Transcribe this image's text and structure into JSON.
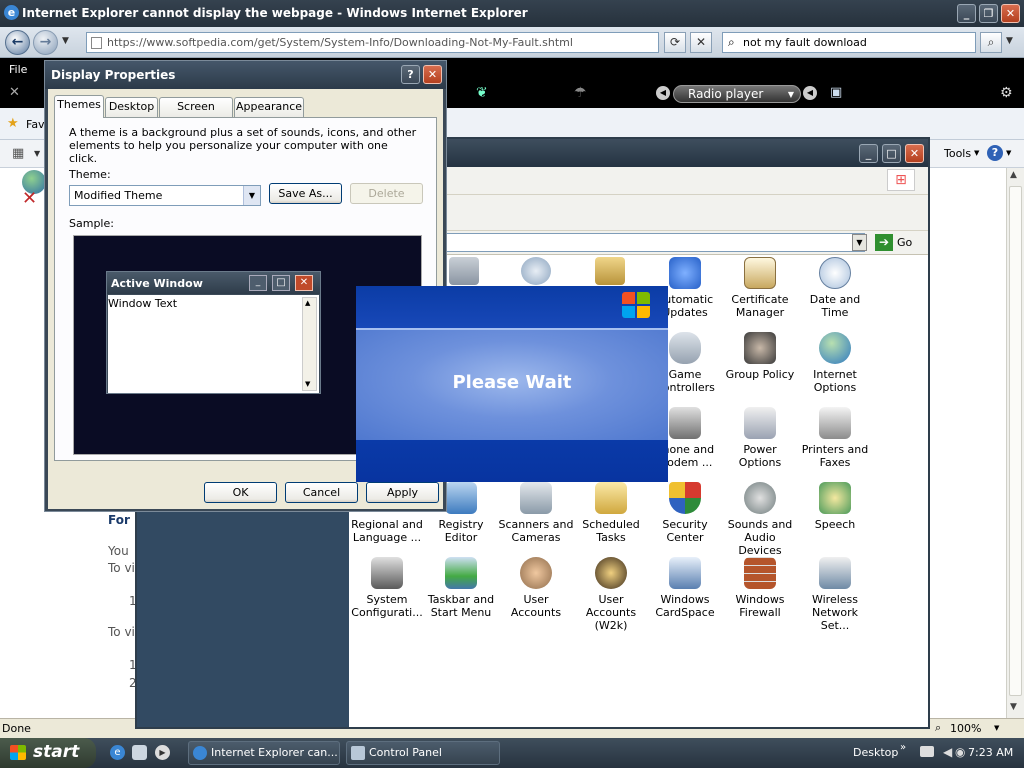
{
  "ie": {
    "title": "Internet Explorer cannot display the webpage - Windows Internet Explorer",
    "address": "https://www.softpedia.com/get/System/System-Info/Downloading-Not-My-Fault.shtml",
    "address_host": "softpedia.com",
    "search_value": "not my fault download",
    "menu_file": "File",
    "favorites_partial": "Fav",
    "radio_player": "Radio player",
    "tools": "Tools",
    "go_label": "Go",
    "status_text": "Done",
    "zoom": "100%",
    "content_fragments": [
      "For",
      "You",
      "To vi",
      "1",
      "To vi",
      "1",
      "2"
    ]
  },
  "display_properties": {
    "title": "Display Properties",
    "tabs": [
      "Themes",
      "Desktop",
      "Screen Saver",
      "Appearance"
    ],
    "description": "A theme is a background plus a set of sounds, icons, and other elements to help you personalize your computer with one click.",
    "theme_label": "Theme:",
    "theme_value": "Modified Theme",
    "save_as": "Save As...",
    "delete": "Delete",
    "sample_label": "Sample:",
    "sample_window_title": "Active Window",
    "sample_window_text": "Window Text",
    "ok": "OK",
    "cancel": "Cancel",
    "apply": "Apply"
  },
  "please_wait": {
    "text": "Please Wait"
  },
  "control_panel": {
    "items": [
      {
        "label": "Automatic Updates",
        "color": "#3a7bd5"
      },
      {
        "label": "Certificate Manager",
        "color": "#b89b5e"
      },
      {
        "label": "Date and Time",
        "color": "#7aa0c8"
      },
      {
        "label": "Game Controllers",
        "color": "#9aa4b0"
      },
      {
        "label": "Group Policy",
        "color": "#555555"
      },
      {
        "label": "Internet Options",
        "color": "#3b8fd0"
      },
      {
        "label": "Phone and Modem ...",
        "color": "#777777"
      },
      {
        "label": "Power Options",
        "color": "#a0a8b8"
      },
      {
        "label": "Printers and Faxes",
        "color": "#8c8c8c"
      },
      {
        "label": "Regional and Language ...",
        "color": "#4a90d9"
      },
      {
        "label": "Registry Editor",
        "color": "#3d7bbf"
      },
      {
        "label": "Scanners and Cameras",
        "color": "#8a9aa8"
      },
      {
        "label": "Scheduled Tasks",
        "color": "#d6b45a"
      },
      {
        "label": "Security Center",
        "color": "#c0392b"
      },
      {
        "label": "Sounds and Audio Devices",
        "color": "#7f8c8d"
      },
      {
        "label": "Speech",
        "color": "#4a9a5a"
      },
      {
        "label": "System Configurati...",
        "color": "#6a6a6a"
      },
      {
        "label": "Taskbar and Start Menu",
        "color": "#4477aa"
      },
      {
        "label": "User Accounts",
        "color": "#8e6b4a"
      },
      {
        "label": "User Accounts (W2k)",
        "color": "#7a5a3a"
      },
      {
        "label": "Windows CardSpace",
        "color": "#5a7fb0"
      },
      {
        "label": "Windows Firewall",
        "color": "#b5552b"
      },
      {
        "label": "Wireless Network Set...",
        "color": "#6f8aa5"
      }
    ]
  },
  "taskbar": {
    "start": "start",
    "tasks": [
      "Internet Explorer can...",
      "Control Panel"
    ],
    "desktop": "Desktop",
    "time": "7:23 AM"
  }
}
